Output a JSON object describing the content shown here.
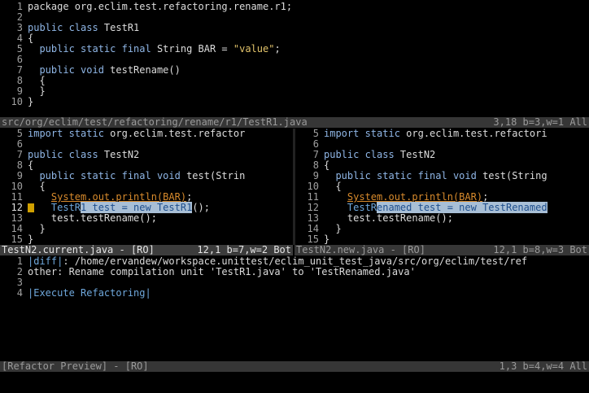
{
  "top_pane": {
    "lines": [
      {
        "n": "1",
        "parts": [
          {
            "t": "package org.eclim.test.refactoring.rename.r1;",
            "c": ""
          }
        ]
      },
      {
        "n": "2",
        "parts": []
      },
      {
        "n": "3",
        "parts": [
          {
            "t": "public class ",
            "c": "kw"
          },
          {
            "t": "TestR1",
            "c": ""
          }
        ]
      },
      {
        "n": "4",
        "parts": [
          {
            "t": "{",
            "c": ""
          }
        ]
      },
      {
        "n": "5",
        "parts": [
          {
            "t": "  public static final ",
            "c": "kw"
          },
          {
            "t": "String BAR = ",
            "c": ""
          },
          {
            "t": "\"value\"",
            "c": "str"
          },
          {
            "t": ";",
            "c": ""
          }
        ]
      },
      {
        "n": "6",
        "parts": []
      },
      {
        "n": "7",
        "parts": [
          {
            "t": "  public void ",
            "c": "kw"
          },
          {
            "t": "testRename()",
            "c": ""
          }
        ]
      },
      {
        "n": "8",
        "parts": [
          {
            "t": "  {",
            "c": ""
          }
        ]
      },
      {
        "n": "9",
        "parts": [
          {
            "t": "  }",
            "c": ""
          }
        ]
      },
      {
        "n": "10",
        "parts": [
          {
            "t": "}",
            "c": ""
          }
        ]
      }
    ],
    "status": {
      "file": "src/org/eclim/test/refactoring/rename/r1/TestR1.java",
      "pos": "3,18 b=3,w=1 All"
    }
  },
  "left_pane": {
    "lines": [
      {
        "n": "5",
        "parts": [
          {
            "t": "import static ",
            "c": "kw"
          },
          {
            "t": "org.eclim.test.refactor",
            "c": ""
          }
        ]
      },
      {
        "n": "6",
        "parts": []
      },
      {
        "n": "7",
        "parts": [
          {
            "t": "public class ",
            "c": "kw"
          },
          {
            "t": "TestN2",
            "c": ""
          }
        ]
      },
      {
        "n": "8",
        "parts": [
          {
            "t": "{",
            "c": ""
          }
        ]
      },
      {
        "n": "9",
        "parts": [
          {
            "t": "  public static final void ",
            "c": "kw"
          },
          {
            "t": "test(Strin",
            "c": ""
          }
        ]
      },
      {
        "n": "10",
        "parts": [
          {
            "t": "  {",
            "c": ""
          }
        ]
      },
      {
        "n": "11",
        "parts": [
          {
            "t": "    ",
            "c": ""
          },
          {
            "t": "System.out.println(BAR)",
            "c": "dep"
          },
          {
            "t": ";",
            "c": ""
          }
        ]
      },
      {
        "n": "12",
        "cur": true,
        "parts": [
          {
            "t": "    TestR",
            "c": "lnk"
          },
          {
            "t": "1 test = new TestR1",
            "c": "hl"
          },
          {
            "t": "();",
            "c": ""
          }
        ]
      },
      {
        "n": "13",
        "parts": [
          {
            "t": "    test.testRename();",
            "c": ""
          }
        ]
      },
      {
        "n": "14",
        "parts": [
          {
            "t": "  }",
            "c": ""
          }
        ]
      },
      {
        "n": "15",
        "parts": [
          {
            "t": "}",
            "c": ""
          }
        ]
      }
    ],
    "status": {
      "file": "TestN2.current.java - [RO]",
      "pos": "12,1 b=7,w=2 Bot"
    }
  },
  "right_pane": {
    "lines": [
      {
        "n": "5",
        "parts": [
          {
            "t": "import static ",
            "c": "kw"
          },
          {
            "t": "org.eclim.test.refactori",
            "c": ""
          }
        ]
      },
      {
        "n": "6",
        "parts": []
      },
      {
        "n": "7",
        "parts": [
          {
            "t": "public class ",
            "c": "kw"
          },
          {
            "t": "TestN2",
            "c": ""
          }
        ]
      },
      {
        "n": "8",
        "parts": [
          {
            "t": "{",
            "c": ""
          }
        ]
      },
      {
        "n": "9",
        "parts": [
          {
            "t": "  public static final void ",
            "c": "kw"
          },
          {
            "t": "test(String",
            "c": ""
          }
        ]
      },
      {
        "n": "10",
        "parts": [
          {
            "t": "  {",
            "c": ""
          }
        ]
      },
      {
        "n": "11",
        "parts": [
          {
            "t": "    ",
            "c": ""
          },
          {
            "t": "System.out.println(BAR)",
            "c": "dep"
          },
          {
            "t": ";",
            "c": ""
          }
        ]
      },
      {
        "n": "12",
        "parts": [
          {
            "t": "    TestR",
            "c": "lnk"
          },
          {
            "t": "enamed test = new TestRenamed",
            "c": "hl"
          }
        ]
      },
      {
        "n": "13",
        "parts": [
          {
            "t": "    test.testRename();",
            "c": ""
          }
        ]
      },
      {
        "n": "14",
        "parts": [
          {
            "t": "  }",
            "c": ""
          }
        ]
      },
      {
        "n": "15",
        "parts": [
          {
            "t": "}",
            "c": ""
          }
        ]
      }
    ],
    "status": {
      "file": "TestN2.new.java - [RO]",
      "pos": "12,1 b=8,w=3 Bot"
    }
  },
  "preview_pane": {
    "lines": [
      {
        "n": "1",
        "parts": [
          {
            "t": "|diff|",
            "c": "lnk"
          },
          {
            "t": ": /home/ervandew/workspace.unittest/eclim_unit_test_java/src/org/eclim/test/ref",
            "c": ""
          }
        ]
      },
      {
        "n": "2",
        "parts": [
          {
            "t": "other: Rename compilation unit 'TestR1.java' to 'TestRenamed.java'",
            "c": ""
          }
        ]
      },
      {
        "n": "3",
        "parts": []
      },
      {
        "n": "4",
        "parts": [
          {
            "t": "|Execute Refactoring|",
            "c": "lnk"
          }
        ]
      }
    ],
    "status": {
      "file": "[Refactor Preview] - [RO]",
      "pos": "1,3 b=4,w=4 All"
    }
  }
}
